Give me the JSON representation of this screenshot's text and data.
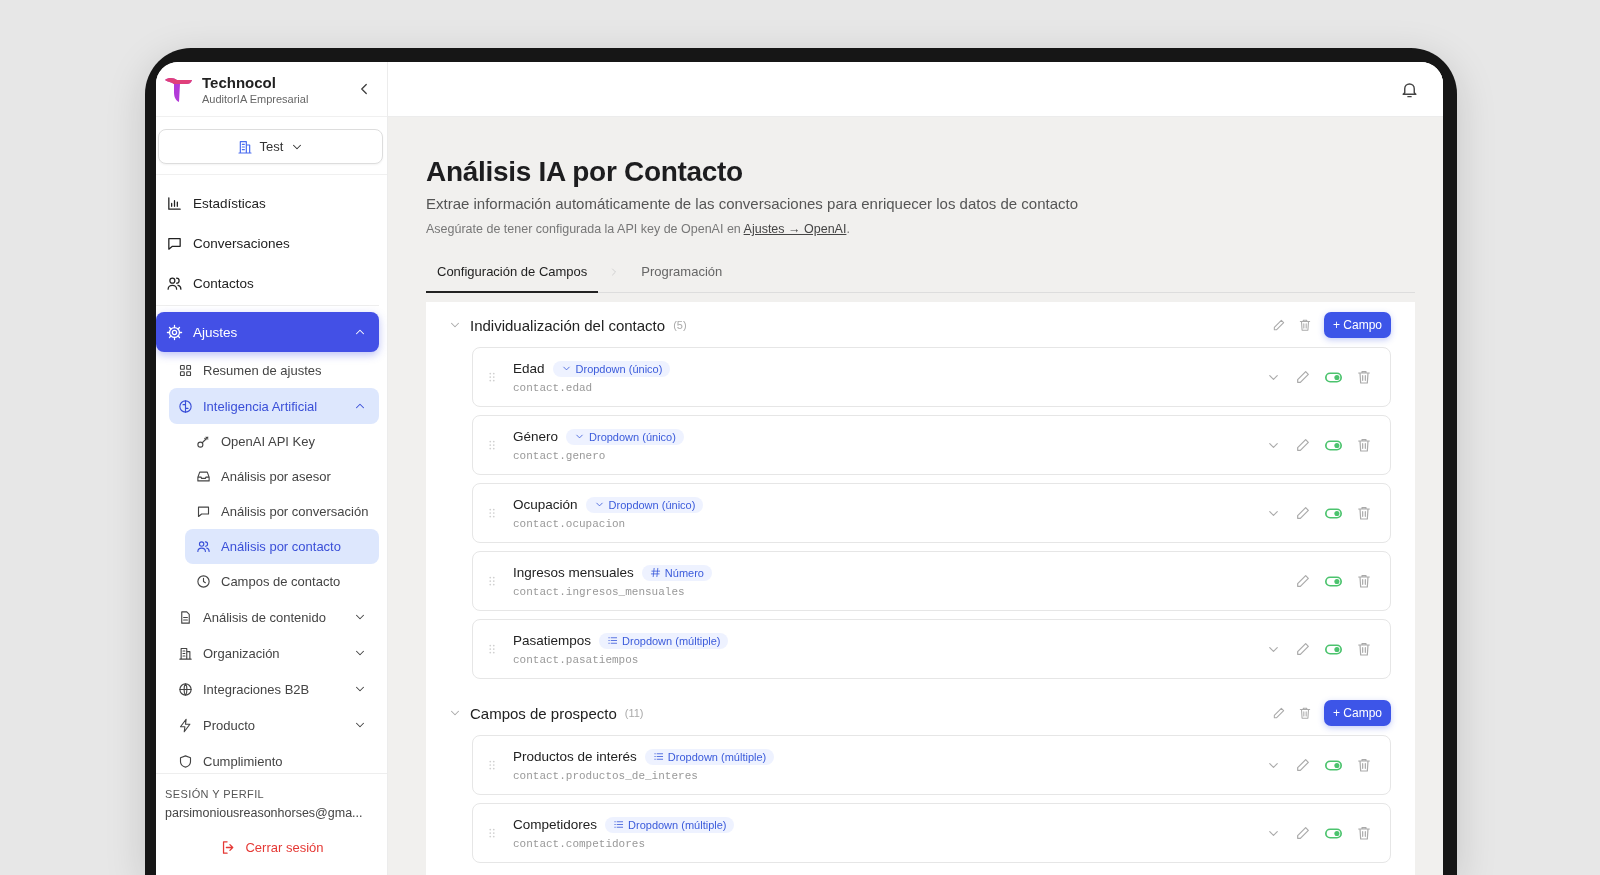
{
  "sidebar": {
    "brand": {
      "name": "Technocol",
      "subtitle": "AuditorIA Empresarial"
    },
    "workspace": "Test",
    "nav": [
      {
        "label": "Estadísticas",
        "kind": "link",
        "selected": false
      },
      {
        "label": "Conversaciones",
        "kind": "link",
        "selected": false
      },
      {
        "label": "Contactos",
        "kind": "link",
        "selected": false
      },
      {
        "label": "Ajustes",
        "kind": "group",
        "selected": true,
        "expanded": true,
        "children": [
          {
            "label": "Resumen de ajustes",
            "kind": "link",
            "selected": false
          },
          {
            "label": "Inteligencia Artificial",
            "kind": "group",
            "selected": true,
            "expanded": true,
            "children": [
              {
                "label": "OpenAI API Key",
                "kind": "link",
                "selected": false
              },
              {
                "label": "Análisis por asesor",
                "kind": "link",
                "selected": false
              },
              {
                "label": "Análisis por conversación",
                "kind": "link",
                "selected": false
              },
              {
                "label": "Análisis por contacto",
                "kind": "link",
                "selected": true
              },
              {
                "label": "Campos de contacto",
                "kind": "link",
                "selected": false
              }
            ]
          },
          {
            "label": "Análisis de contenido",
            "kind": "group",
            "selected": false,
            "expanded": false
          },
          {
            "label": "Organización",
            "kind": "group",
            "selected": false,
            "expanded": false
          },
          {
            "label": "Integraciones B2B",
            "kind": "group",
            "selected": false,
            "expanded": false
          },
          {
            "label": "Producto",
            "kind": "group",
            "selected": false,
            "expanded": false
          },
          {
            "label": "Cumplimiento",
            "kind": "link",
            "selected": false
          }
        ]
      }
    ],
    "footer": {
      "heading": "SESIÓN Y PERFIL",
      "email": "parsimoniousreasonhorses@gma...",
      "logout": "Cerrar sesión"
    }
  },
  "main": {
    "title": "Análisis IA por Contacto",
    "subtitle": "Extrae información automáticamente de las conversaciones para enriquecer los datos de contacto",
    "note": {
      "text": "Asegúrate de tener configurada la API key de OpenAI en",
      "link": "Ajustes → OpenAI",
      "end": "."
    },
    "tabs": [
      {
        "label": "Configuración de Campos",
        "selected": true
      },
      {
        "label": "Programación",
        "selected": false
      }
    ],
    "sections": [
      {
        "title": "Individualización del contacto",
        "count": "(5)",
        "expanded": true,
        "add_button": "+ Campo",
        "fields": [
          {
            "name": "Edad",
            "type": "Dropdown (único)",
            "kind": "single",
            "key": "contact.edad",
            "enabled": true
          },
          {
            "name": "Género",
            "type": "Dropdown (único)",
            "kind": "single",
            "key": "contact.genero",
            "enabled": true
          },
          {
            "name": "Ocupación",
            "type": "Dropdown (único)",
            "kind": "single",
            "key": "contact.ocupacion",
            "enabled": true
          },
          {
            "name": "Ingresos mensuales",
            "type": "Número",
            "kind": "number",
            "key": "contact.ingresos_mensuales",
            "enabled": true
          },
          {
            "name": "Pasatiempos",
            "type": "Dropdown (múltiple)",
            "kind": "multiple",
            "key": "contact.pasatiempos",
            "enabled": true
          }
        ]
      },
      {
        "title": "Campos de prospecto",
        "count": "(11)",
        "expanded": true,
        "add_button": "+ Campo",
        "fields": [
          {
            "name": "Productos de interés",
            "type": "Dropdown (múltiple)",
            "kind": "multiple",
            "key": "contact.productos_de_interes",
            "enabled": true
          },
          {
            "name": "Competidores",
            "type": "Dropdown (múltiple)",
            "kind": "multiple",
            "key": "contact.competidores",
            "enabled": true
          }
        ]
      }
    ]
  }
}
